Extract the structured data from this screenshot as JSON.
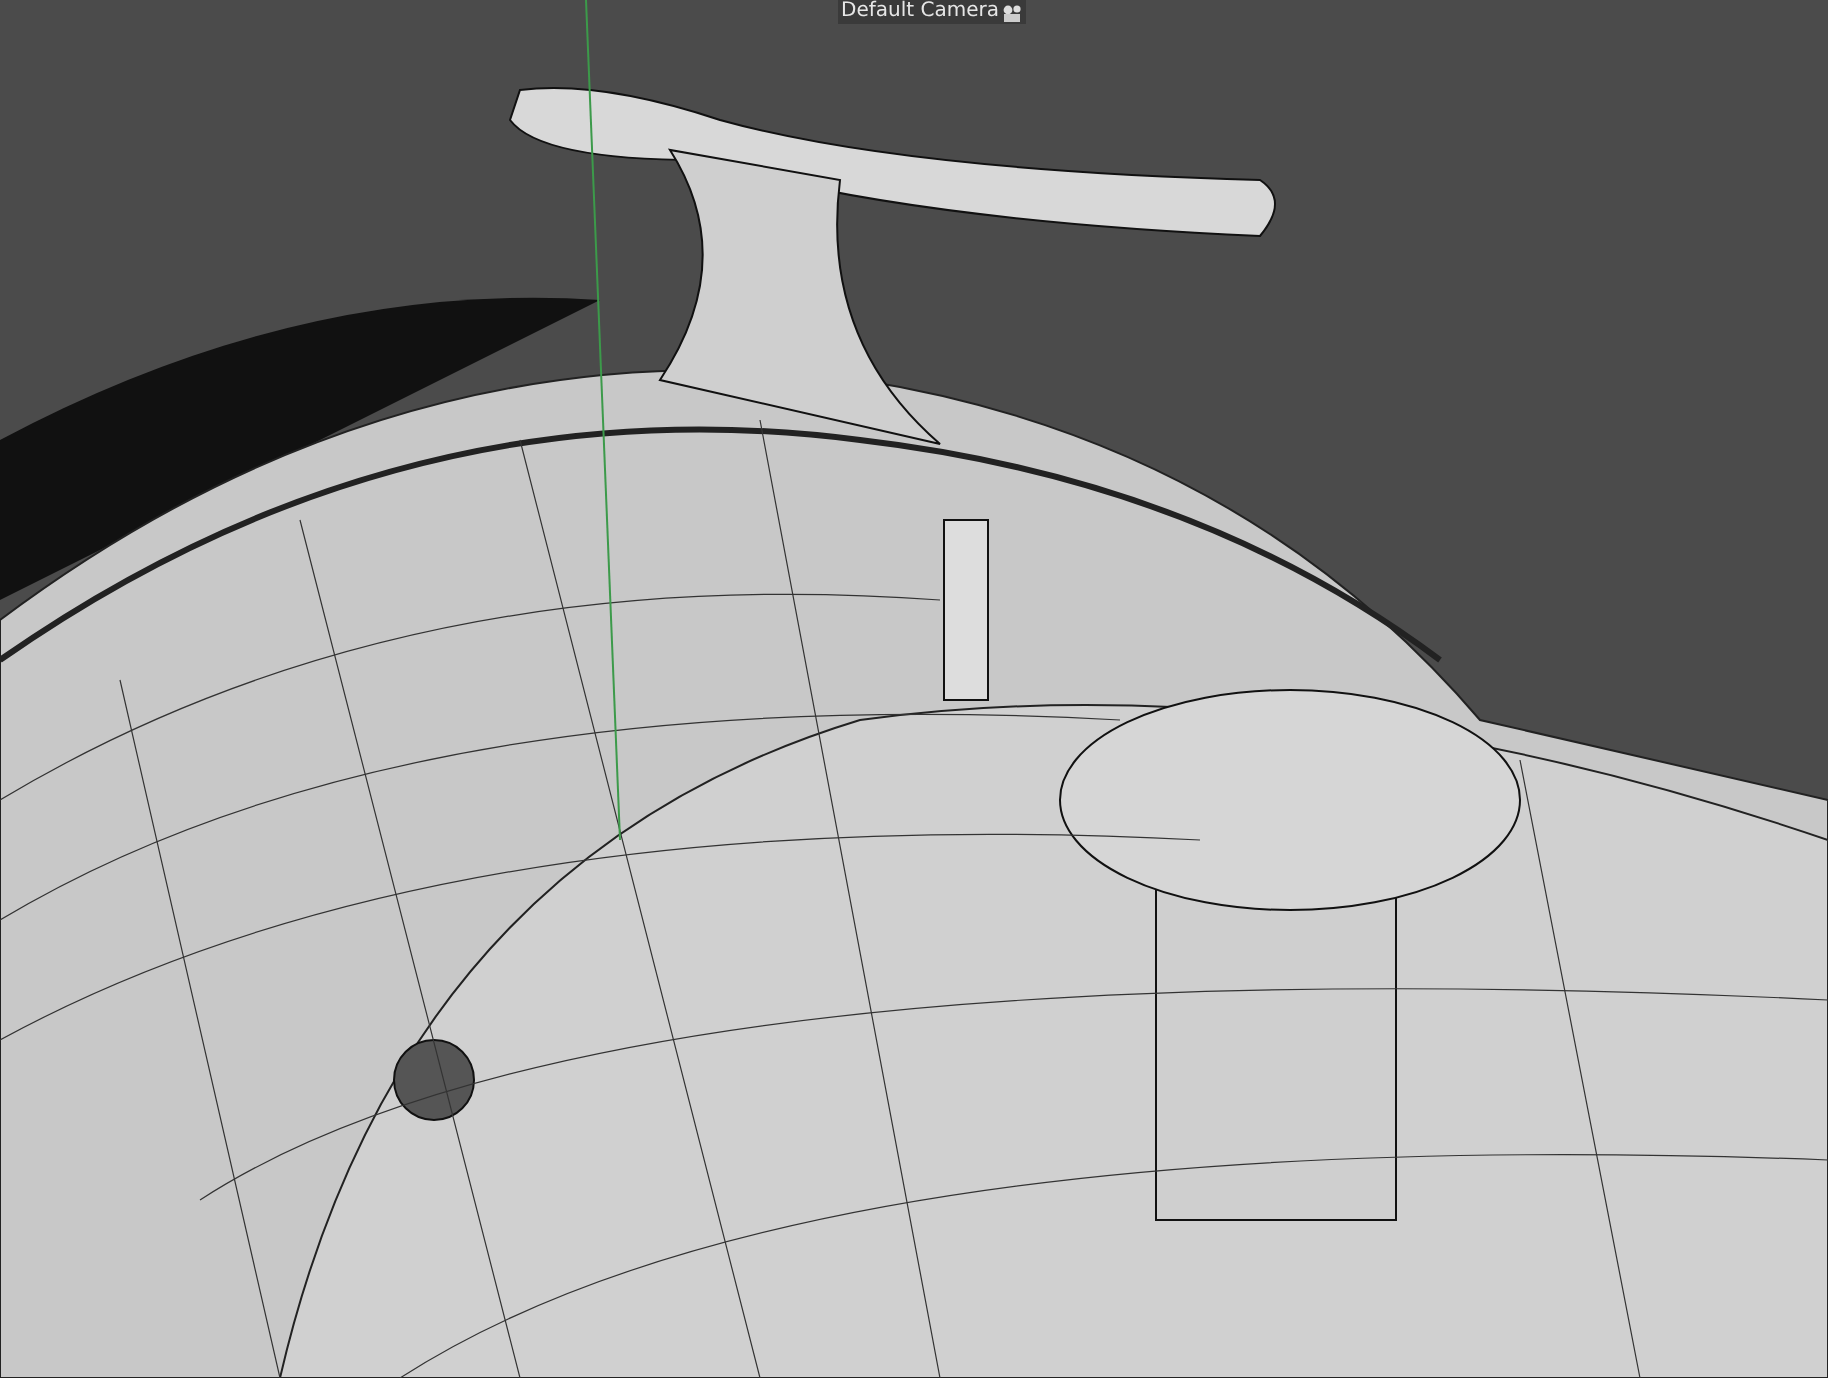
{
  "viewport": {
    "camera_label": "Default Camera"
  }
}
